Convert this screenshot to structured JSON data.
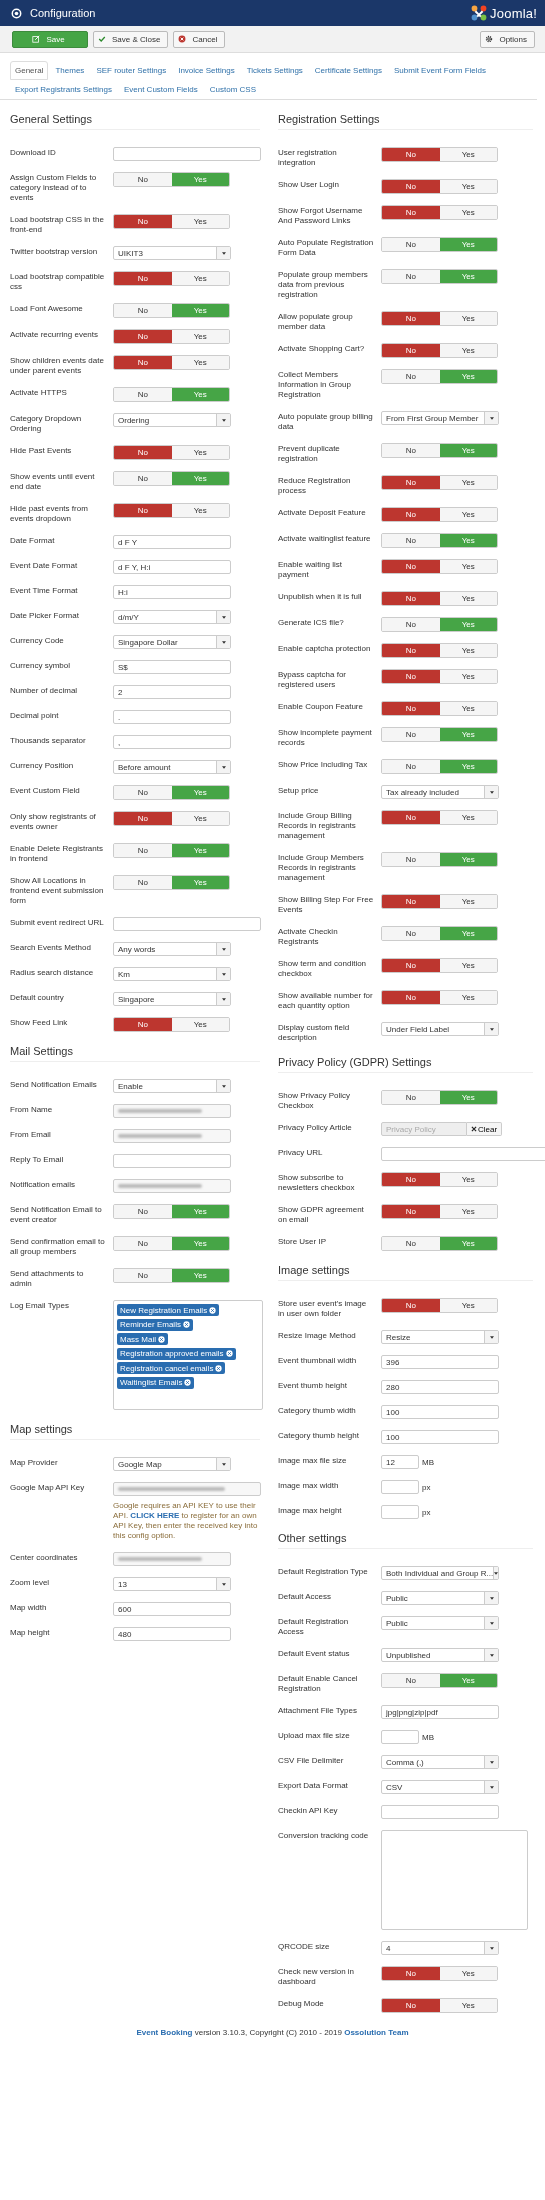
{
  "header": {
    "title": "Configuration",
    "brand": "Joomla!"
  },
  "toolbar": {
    "buttons": [
      {
        "label": "Save",
        "kind": "save"
      },
      {
        "label": "Save & Close",
        "kind": "check"
      },
      {
        "label": "Cancel",
        "kind": "cancel"
      }
    ],
    "options": "Options"
  },
  "tabs": [
    {
      "label": "General",
      "selected": true
    },
    {
      "label": "Themes",
      "selected": false
    },
    {
      "label": "SEF router Settings",
      "selected": false
    },
    {
      "label": "Invoice Settings",
      "selected": false
    },
    {
      "label": "Tickets Settings",
      "selected": false
    },
    {
      "label": "Certificate Settings",
      "selected": false
    },
    {
      "label": "Submit Event Form Fields",
      "selected": false
    },
    {
      "label": "Export Registrants Settings",
      "selected": false
    },
    {
      "label": "Event Custom Fields",
      "selected": false
    },
    {
      "label": "Custom CSS",
      "selected": false
    }
  ],
  "columns": [
    [
      {
        "title": "General Settings",
        "fields": [
          {
            "label": "Download ID",
            "kind": "wide-text"
          },
          {
            "label": "Assign Custom Fields to category instead of to events",
            "kind": "toggle",
            "options": [
              "No",
              "Yes"
            ],
            "on": true
          },
          {
            "label": "Load bootstrap CSS in the front-end",
            "kind": "toggle",
            "options": [
              "No",
              "Yes"
            ],
            "on": false
          },
          {
            "label": "Twitter bootstrap version",
            "kind": "select",
            "value": "UIKIT3"
          },
          {
            "label": "Load bootstrap compatible css",
            "kind": "toggle",
            "options": [
              "No",
              "Yes"
            ],
            "on": false
          },
          {
            "label": "Load Font Awesome",
            "kind": "toggle",
            "options": [
              "No",
              "Yes"
            ],
            "on": true
          },
          {
            "label": "Activate recurring events",
            "kind": "toggle",
            "options": [
              "No",
              "Yes"
            ],
            "on": false
          },
          {
            "label": "Show children events date under parent events",
            "kind": "toggle",
            "options": [
              "No",
              "Yes"
            ],
            "on": false
          },
          {
            "label": "Activate HTTPS",
            "kind": "toggle",
            "options": [
              "No",
              "Yes"
            ],
            "on": true
          },
          {
            "label": "Category Dropdown Ordering",
            "kind": "select",
            "value": "Ordering"
          },
          {
            "label": "Hide Past Events",
            "kind": "toggle",
            "options": [
              "No",
              "Yes"
            ],
            "on": false
          },
          {
            "label": "Show events until event end date",
            "kind": "toggle",
            "options": [
              "No",
              "Yes"
            ],
            "on": true
          },
          {
            "label": "Hide past events from events dropdown",
            "kind": "toggle",
            "options": [
              "No",
              "Yes"
            ],
            "on": false
          },
          {
            "label": "Date Format",
            "kind": "text",
            "value": "d F Y"
          },
          {
            "label": "Event Date Format",
            "kind": "text",
            "value": "d F Y, H:i"
          },
          {
            "label": "Event Time Format",
            "kind": "text",
            "value": "H:i"
          },
          {
            "label": "Date Picker Format",
            "kind": "select",
            "value": "d/m/Y"
          },
          {
            "label": "Currency Code",
            "kind": "select",
            "value": "Singapore Dollar"
          },
          {
            "label": "Currency symbol",
            "kind": "text",
            "value": "S$"
          },
          {
            "label": "Number of decimal",
            "kind": "text",
            "value": "2"
          },
          {
            "label": "Decimal point",
            "kind": "text",
            "value": "."
          },
          {
            "label": "Thousands separator",
            "kind": "text",
            "value": ","
          },
          {
            "label": "Currency Position",
            "kind": "select",
            "value": "Before amount"
          },
          {
            "label": "Event Custom Field",
            "kind": "toggle",
            "options": [
              "No",
              "Yes"
            ],
            "on": true
          },
          {
            "label": "Only show registrants of events owner",
            "kind": "toggle",
            "options": [
              "No",
              "Yes"
            ],
            "on": false
          },
          {
            "label": "Enable Delete Registrants in frontend",
            "kind": "toggle",
            "options": [
              "No",
              "Yes"
            ],
            "on": true
          },
          {
            "label": "Show All Locations in frontend event submission form",
            "kind": "toggle",
            "options": [
              "No",
              "Yes"
            ],
            "on": true
          },
          {
            "label": "Submit event redirect URL",
            "kind": "wide-text"
          },
          {
            "label": "Search Events Method",
            "kind": "select",
            "value": "Any words"
          },
          {
            "label": "Radius search distance",
            "kind": "select",
            "value": "Km"
          },
          {
            "label": "Default country",
            "kind": "select",
            "value": "Singapore"
          },
          {
            "label": "Show Feed Link",
            "kind": "toggle",
            "options": [
              "No",
              "Yes"
            ],
            "on": false
          }
        ]
      },
      {
        "title": "Mail Settings",
        "fields": [
          {
            "label": "Send Notification Emails",
            "kind": "select",
            "value": "Enable"
          },
          {
            "label": "From Name",
            "kind": "redacted"
          },
          {
            "label": "From Email",
            "kind": "redacted"
          },
          {
            "label": "Reply To Email",
            "kind": "text"
          },
          {
            "label": "Notification emails",
            "kind": "redacted"
          },
          {
            "label": "Send Notification Email to event creator",
            "kind": "toggle",
            "options": [
              "No",
              "Yes"
            ],
            "on": true
          },
          {
            "label": "Send confirmation email to all group members",
            "kind": "toggle",
            "options": [
              "No",
              "Yes"
            ],
            "on": true
          },
          {
            "label": "Send attachments to admin",
            "kind": "toggle",
            "options": [
              "No",
              "Yes"
            ],
            "on": true
          },
          {
            "label": "Log Email Types",
            "kind": "tags",
            "tags": [
              "New Registration Emails",
              "Reminder Emails",
              "Mass Mail",
              "Registration approved emails",
              "Registration cancel emails",
              "Waitinglist Emails"
            ]
          }
        ]
      },
      {
        "title": "Map settings",
        "fields": [
          {
            "label": "Map Provider",
            "kind": "select",
            "value": "Google Map"
          },
          {
            "label": "Google Map API Key",
            "kind": "wide-redacted",
            "help": [
              {
                "text": "Google requires an API KEY to use their API.",
                "link": false
              },
              {
                "text": "CLICK HERE",
                "link": true
              },
              {
                "text": "to register for an own API Key, then enter the received key into this config option.",
                "link": false
              }
            ]
          },
          {
            "label": "Center coordinates",
            "kind": "redacted"
          },
          {
            "label": "Zoom level",
            "kind": "select",
            "value": "13"
          },
          {
            "label": "Map width",
            "kind": "text",
            "value": "600"
          },
          {
            "label": "Map height",
            "kind": "text",
            "value": "480"
          }
        ]
      }
    ],
    [
      {
        "title": "Registration Settings",
        "fields": [
          {
            "label": "User registration integration",
            "kind": "toggle",
            "options": [
              "No",
              "Yes"
            ],
            "on": false
          },
          {
            "label": "Show User Login",
            "kind": "toggle",
            "options": [
              "No",
              "Yes"
            ],
            "on": false
          },
          {
            "label": "Show Forgot Username And Password Links",
            "kind": "toggle",
            "options": [
              "No",
              "Yes"
            ],
            "on": false
          },
          {
            "label": "Auto Populate Registration Form Data",
            "kind": "toggle",
            "options": [
              "No",
              "Yes"
            ],
            "on": true
          },
          {
            "label": "Populate group members data from previous registration",
            "kind": "toggle",
            "options": [
              "No",
              "Yes"
            ],
            "on": true
          },
          {
            "label": "Allow populate group member data",
            "kind": "toggle",
            "options": [
              "No",
              "Yes"
            ],
            "on": false
          },
          {
            "label": "Activate Shopping Cart?",
            "kind": "toggle",
            "options": [
              "No",
              "Yes"
            ],
            "on": false
          },
          {
            "label": "Collect Members Information in Group Registration",
            "kind": "toggle",
            "options": [
              "No",
              "Yes"
            ],
            "on": true
          },
          {
            "label": "Auto populate group billing data",
            "kind": "select",
            "value": "From First Group Member"
          },
          {
            "label": "Prevent duplicate registration",
            "kind": "toggle",
            "options": [
              "No",
              "Yes"
            ],
            "on": true
          },
          {
            "label": "Reduce Registration process",
            "kind": "toggle",
            "options": [
              "No",
              "Yes"
            ],
            "on": false
          },
          {
            "label": "Activate Deposit Feature",
            "kind": "toggle",
            "options": [
              "No",
              "Yes"
            ],
            "on": false
          },
          {
            "label": "Activate waitinglist feature",
            "kind": "toggle",
            "options": [
              "No",
              "Yes"
            ],
            "on": true
          },
          {
            "label": "Enable waiting list payment",
            "kind": "toggle",
            "options": [
              "No",
              "Yes"
            ],
            "on": false
          },
          {
            "label": "Unpublish when it is full",
            "kind": "toggle",
            "options": [
              "No",
              "Yes"
            ],
            "on": false
          },
          {
            "label": "Generate ICS file?",
            "kind": "toggle",
            "options": [
              "No",
              "Yes"
            ],
            "on": true
          },
          {
            "label": "Enable captcha protection",
            "kind": "toggle",
            "options": [
              "No",
              "Yes"
            ],
            "on": false
          },
          {
            "label": "Bypass captcha for registered users",
            "kind": "toggle",
            "options": [
              "No",
              "Yes"
            ],
            "on": false
          },
          {
            "label": "Enable Coupon Feature",
            "kind": "toggle",
            "options": [
              "No",
              "Yes"
            ],
            "on": false
          },
          {
            "label": "Show incomplete payment records",
            "kind": "toggle",
            "options": [
              "No",
              "Yes"
            ],
            "on": true
          },
          {
            "label": "Show Price Including Tax",
            "kind": "toggle",
            "options": [
              "No",
              "Yes"
            ],
            "on": true
          },
          {
            "label": "Setup price",
            "kind": "select",
            "value": "Tax already included"
          },
          {
            "label": "Include Group Billing Records in registrants management",
            "kind": "toggle",
            "options": [
              "No",
              "Yes"
            ],
            "on": false
          },
          {
            "label": "Include Group Members Records in registrants management",
            "kind": "toggle",
            "options": [
              "No",
              "Yes"
            ],
            "on": true
          },
          {
            "label": "Show Billing Step For Free Events",
            "kind": "toggle",
            "options": [
              "No",
              "Yes"
            ],
            "on": false
          },
          {
            "label": "Activate Checkin Registrants",
            "kind": "toggle",
            "options": [
              "No",
              "Yes"
            ],
            "on": true
          },
          {
            "label": "Show term and condition checkbox",
            "kind": "toggle",
            "options": [
              "No",
              "Yes"
            ],
            "on": false
          },
          {
            "label": "Show available number for each quantity option",
            "kind": "toggle",
            "options": [
              "No",
              "Yes"
            ],
            "on": false
          },
          {
            "label": "Display custom field description",
            "kind": "select",
            "value": "Under Field Label"
          }
        ]
      },
      {
        "title": "Privacy Policy (GDPR) Settings",
        "fields": [
          {
            "label": "Show Privacy Policy Checkbox",
            "kind": "toggle",
            "options": [
              "No",
              "Yes"
            ],
            "on": true
          },
          {
            "label": "Privacy Policy Article",
            "kind": "article",
            "placeholder": "Privacy Policy",
            "button": "Clear"
          },
          {
            "label": "Privacy URL",
            "kind": "full-text"
          },
          {
            "label": "Show subscribe to newsletters checkbox",
            "kind": "toggle",
            "options": [
              "No",
              "Yes"
            ],
            "on": false
          },
          {
            "label": "Show GDPR agreement on email",
            "kind": "toggle",
            "options": [
              "No",
              "Yes"
            ],
            "on": false
          },
          {
            "label": "Store User IP",
            "kind": "toggle",
            "options": [
              "No",
              "Yes"
            ],
            "on": true
          }
        ]
      },
      {
        "title": "Image settings",
        "fields": [
          {
            "label": "Store user event's image in user own folder",
            "kind": "toggle",
            "options": [
              "No",
              "Yes"
            ],
            "on": false
          },
          {
            "label": "Resize Image Method",
            "kind": "select",
            "value": "Resize"
          },
          {
            "label": "Event thumbnail width",
            "kind": "text",
            "value": "396"
          },
          {
            "label": "Event thumb height",
            "kind": "text",
            "value": "280"
          },
          {
            "label": "Category thumb width",
            "kind": "text",
            "value": "100"
          },
          {
            "label": "Category thumb height",
            "kind": "text",
            "value": "100"
          },
          {
            "label": "Image max file size",
            "kind": "short-text",
            "value": "12",
            "unit": "MB"
          },
          {
            "label": "Image max width",
            "kind": "short-text",
            "unit": "px"
          },
          {
            "label": "Image max height",
            "kind": "short-text",
            "unit": "px"
          }
        ]
      },
      {
        "title": "Other settings",
        "fields": [
          {
            "label": "Default Registration Type",
            "kind": "select",
            "value": "Both Individual and Group R..."
          },
          {
            "label": "Default Access",
            "kind": "select",
            "value": "Public"
          },
          {
            "label": "Default Registration Access",
            "kind": "select",
            "value": "Public"
          },
          {
            "label": "Default Event status",
            "kind": "select",
            "value": "Unpublished"
          },
          {
            "label": "Default Enable Cancel Registration",
            "kind": "toggle",
            "options": [
              "No",
              "Yes"
            ],
            "on": true
          },
          {
            "label": "Attachment File Types",
            "kind": "text",
            "value": "jpg|png|zip|pdf"
          },
          {
            "label": "Upload max file size",
            "kind": "short-text",
            "unit": "MB"
          },
          {
            "label": "CSV File Delimiter",
            "kind": "select",
            "value": "Comma (,)"
          },
          {
            "label": "Export Data Format",
            "kind": "select",
            "value": "CSV"
          },
          {
            "label": "Checkin API Key",
            "kind": "text"
          },
          {
            "label": "Conversion tracking code",
            "kind": "textarea"
          },
          {
            "label": "QRCODE size",
            "kind": "select",
            "value": "4"
          },
          {
            "label": "Check new version in dashboard",
            "kind": "toggle",
            "options": [
              "No",
              "Yes"
            ],
            "on": false
          },
          {
            "label": "Debug Mode",
            "kind": "toggle",
            "options": [
              "No",
              "Yes"
            ],
            "on": false
          }
        ]
      }
    ]
  ],
  "footer": [
    {
      "text": "Event Booking",
      "link": true
    },
    {
      "text": "version 3.10.3, Copyright (C) 2010 - 2019",
      "link": false
    },
    {
      "text": "Ossolution Team",
      "link": true
    }
  ]
}
